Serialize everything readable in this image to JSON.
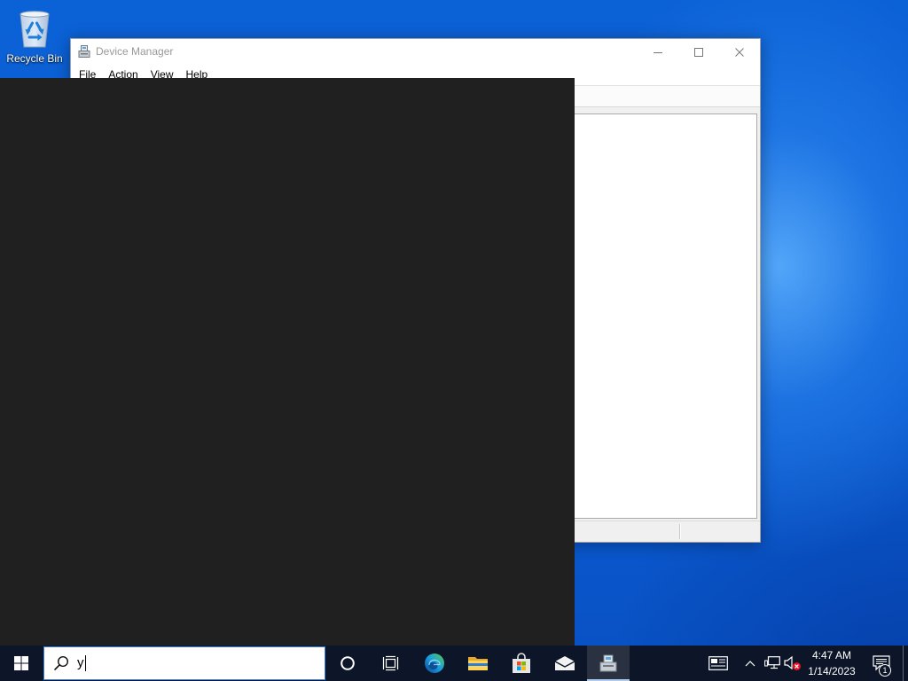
{
  "desktop": {
    "recycle_bin": {
      "label": "Recycle Bin",
      "icon": "recycle-bin-icon"
    }
  },
  "window": {
    "title": "Device Manager",
    "icon": "device-manager-icon",
    "menu": [
      "File",
      "Action",
      "View",
      "Help"
    ],
    "controls": [
      "minimize-icon",
      "maximize-icon",
      "close-icon"
    ]
  },
  "taskbar": {
    "start_icon": "windows-logo-icon",
    "search": {
      "icon": "search-icon",
      "value": "y"
    },
    "buttons": [
      "cortana-icon",
      "task-view-icon",
      "edge-icon",
      "file-explorer-icon",
      "store-icon",
      "mail-icon",
      "device-manager-icon"
    ],
    "active_button": "device-manager-icon",
    "tray": {
      "icons": [
        "news-icon",
        "chevron-up-icon",
        "network-icon",
        "volume-muted-icon"
      ],
      "time": "4:47 AM",
      "date": "1/14/2023",
      "notifications": {
        "icon": "notification-center-icon",
        "count": "1"
      }
    }
  },
  "colors": {
    "desktop": "#0a5cd4",
    "search_panel": "#202020",
    "taskbar": "#0d1628",
    "search_box_border": "#3c83d8",
    "window_title_inactive": "#999999",
    "running_indicator": "#aecbf0"
  }
}
